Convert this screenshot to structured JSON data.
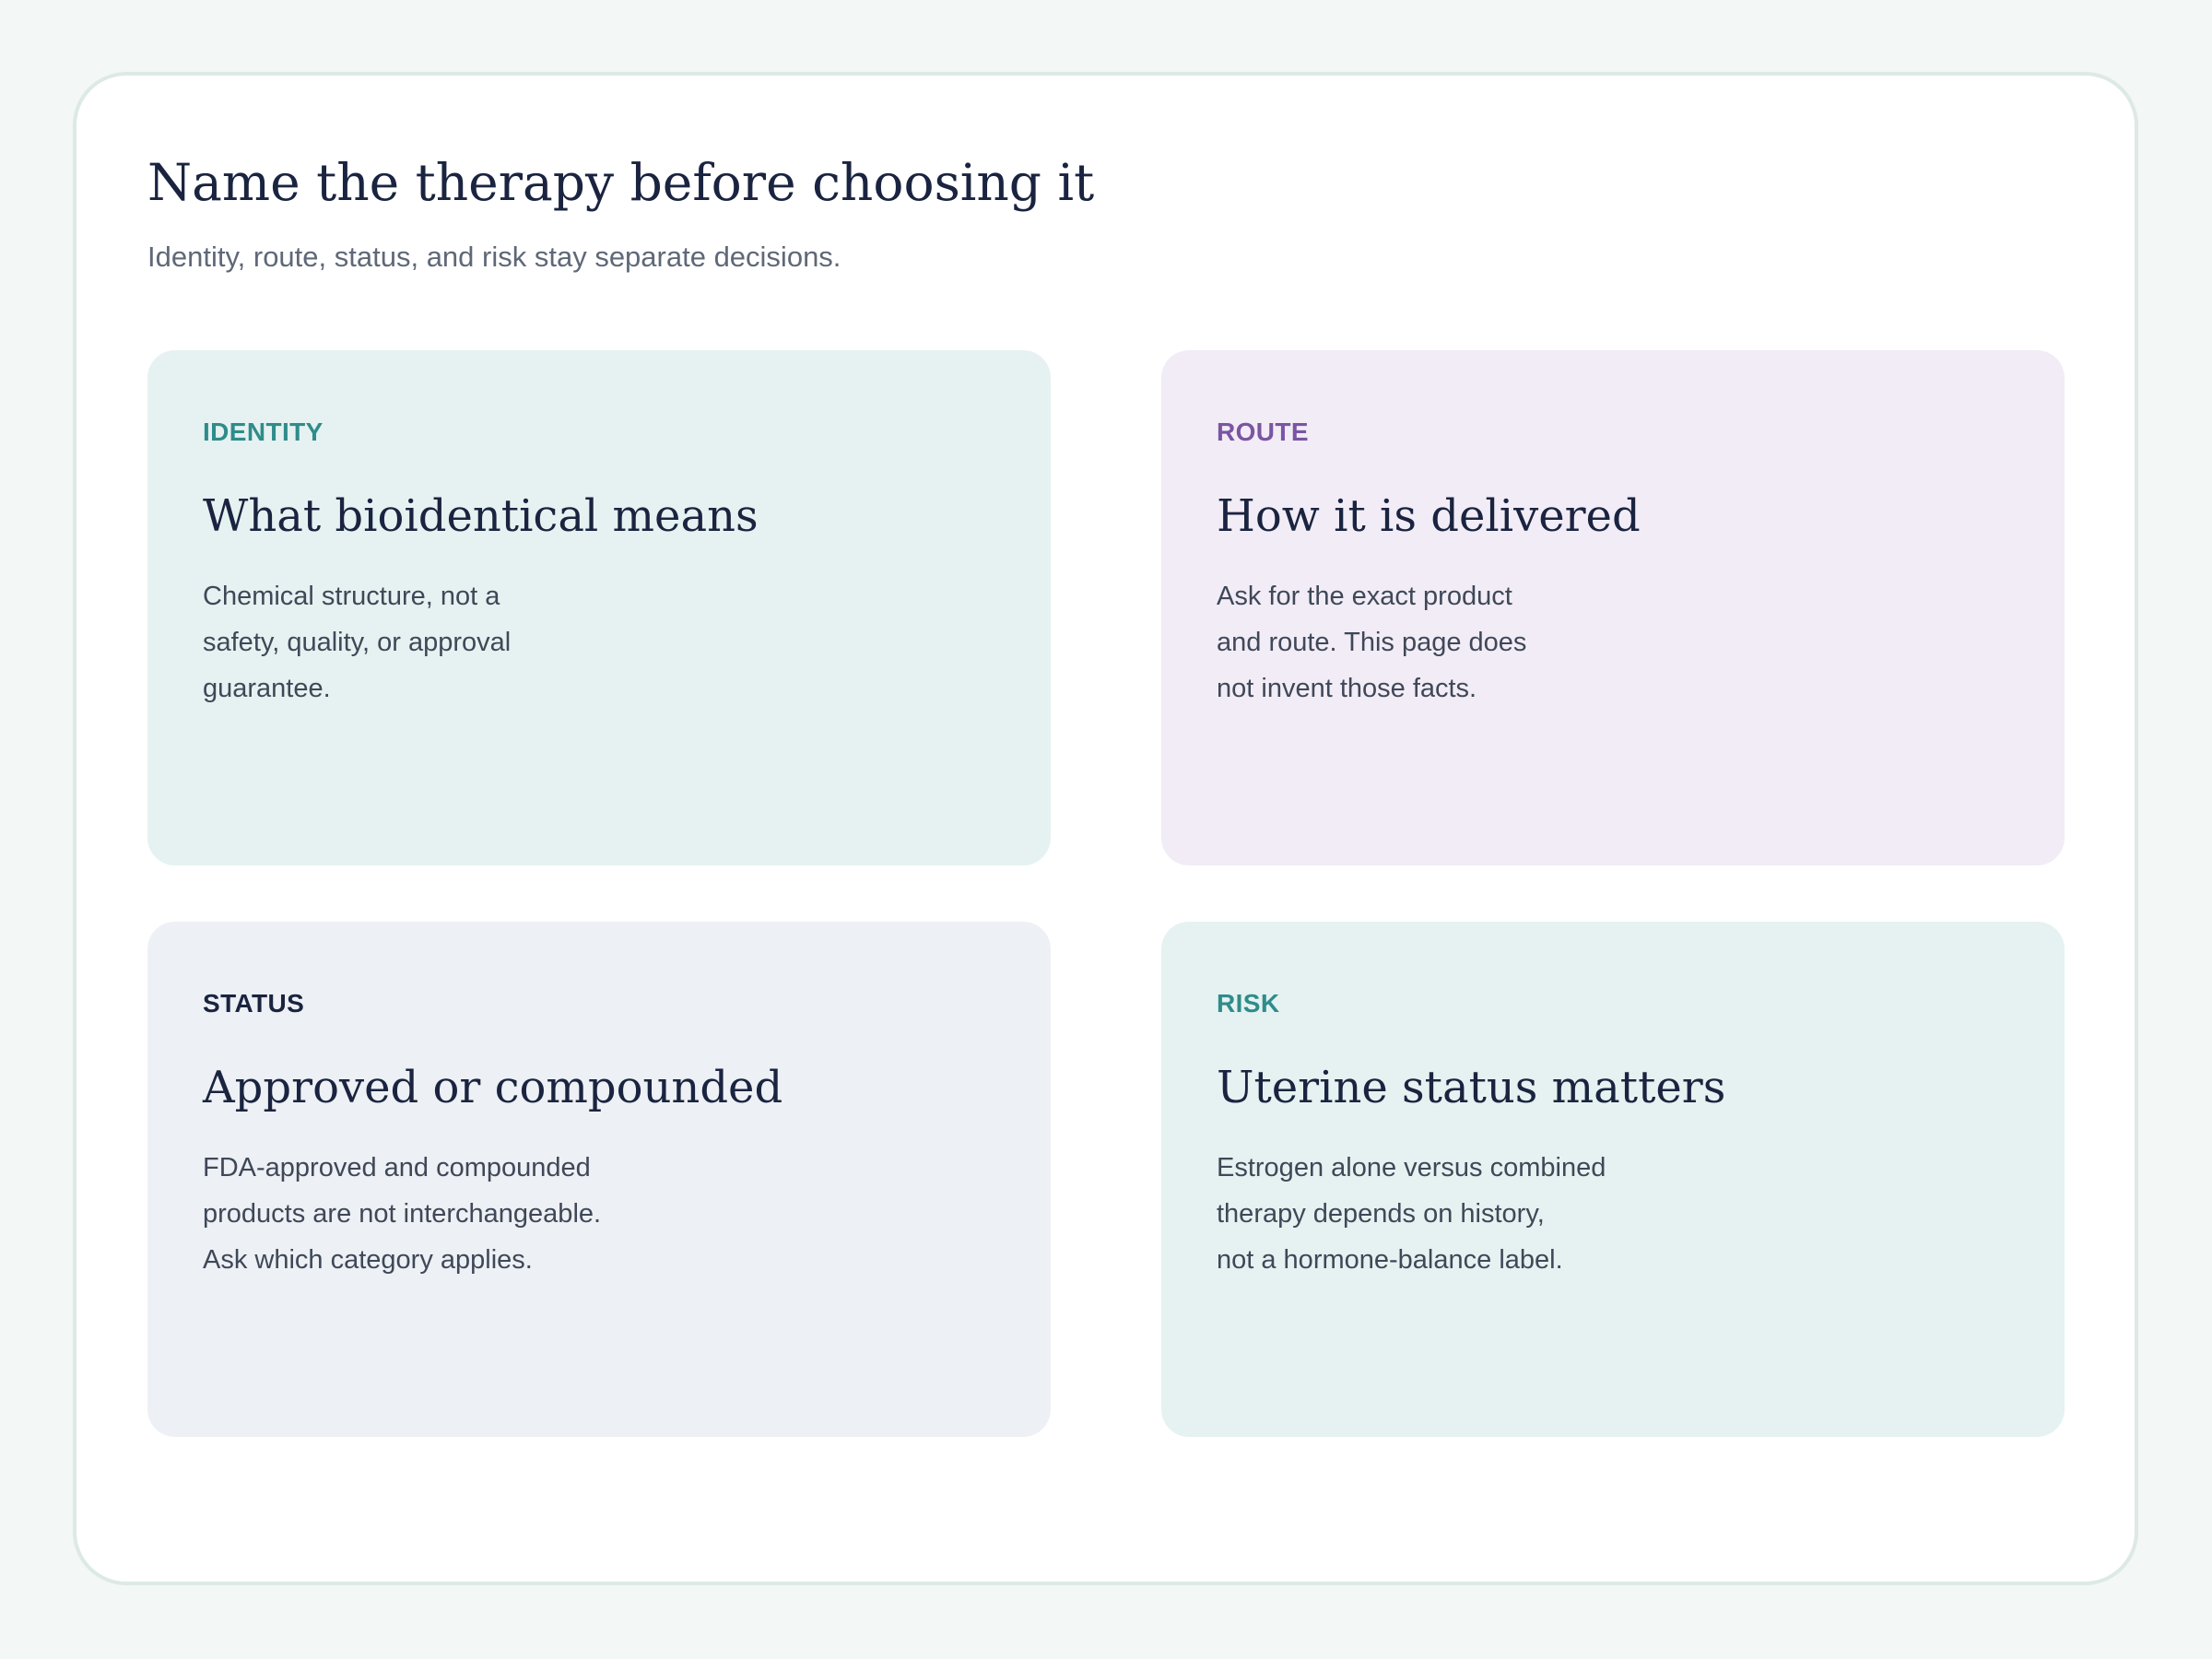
{
  "header": {
    "title": "Name the therapy before choosing it",
    "subtitle": "Identity, route, status, and risk stay separate decisions."
  },
  "cards": [
    {
      "kicker": "IDENTITY",
      "title": "What bioidentical means",
      "body": [
        "Chemical structure, not a",
        "safety, quality, or approval",
        "guarantee."
      ],
      "background": "#e5f2f1",
      "accent": "#2f8c8a"
    },
    {
      "kicker": "ROUTE",
      "title": "How it is delivered",
      "body": [
        "Ask for the exact product",
        "and route. This page does",
        "not invent those facts."
      ],
      "background": "#f2ecf6",
      "accent": "#7a55a3"
    },
    {
      "kicker": "STATUS",
      "title": "Approved or compounded",
      "body": [
        "FDA-approved and compounded",
        "products are not interchangeable.",
        "Ask which category applies."
      ],
      "background": "#edf0f4",
      "accent": "#1a2440"
    },
    {
      "kicker": "RISK",
      "title": "Uterine status matters",
      "body": [
        "Estrogen alone versus combined",
        "therapy depends on history,",
        "not a hormone-balance label."
      ],
      "background": "#e5f2f1",
      "accent": "#2f8c8a"
    }
  ]
}
